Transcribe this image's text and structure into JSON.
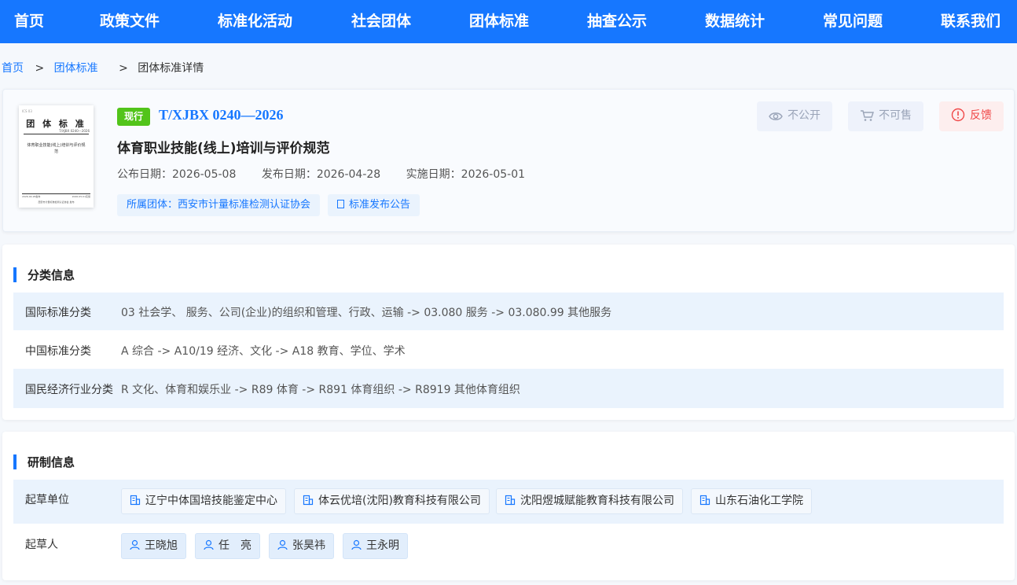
{
  "nav": {
    "items": [
      "首页",
      "政策文件",
      "标准化活动",
      "社会团体",
      "团体标准",
      "抽查公示",
      "数据统计",
      "常见问题",
      "联系我们"
    ]
  },
  "breadcrumb": {
    "home": "首页",
    "section": "团体标准",
    "current": "团体标准详情",
    "separator": ">"
  },
  "standard": {
    "status": "现行",
    "code": "T/XJBX 0240—2026",
    "title": "体育职业技能(线上)培训与评价规范",
    "dates": [
      {
        "label": "公布日期：",
        "value": "2026-05-08"
      },
      {
        "label": "发布日期：",
        "value": "2026-04-28"
      },
      {
        "label": "实施日期：",
        "value": "2026-05-01"
      }
    ],
    "org_tag": "所属团体：西安市计量标准检测认证协会",
    "announcement_tag": "标准发布公告"
  },
  "cover": {
    "ics": "ICS 03",
    "heading": "团 体 标 准",
    "code": "T/XJBX 0240—2026",
    "name": "体育职业技能(线上)培训与评价规范",
    "publish": "2026-04-28发布",
    "implement": "2026-05-01实施",
    "org": "西安市计量标准检测认证协会 发布"
  },
  "actions": {
    "private": "不公开",
    "not_for_sale": "不可售",
    "feedback": "反馈"
  },
  "classification": {
    "heading": "分类信息",
    "rows": [
      {
        "label": "国际标准分类",
        "value": "03 社会学、 服务、公司(企业)的组织和管理、行政、运输 -> 03.080 服务 -> 03.080.99 其他服务"
      },
      {
        "label": "中国标准分类",
        "value": "A 综合 -> A10/19 经济、文化 -> A18 教育、学位、学术"
      },
      {
        "label": "国民经济行业分类",
        "value": "R 文化、体育和娱乐业 -> R89 体育 -> R891 体育组织 -> R8919 其他体育组织"
      }
    ]
  },
  "drafting": {
    "heading": "研制信息",
    "units_label": "起草单位",
    "units": [
      "辽宁中体国培技能鉴定中心",
      "体云优培(沈阳)教育科技有限公司",
      "沈阳煜城赋能教育科技有限公司",
      "山东石油化工学院"
    ],
    "people_label": "起草人",
    "people": [
      "王晓旭",
      "任　亮",
      "张昊祎",
      "王永明"
    ]
  },
  "colors": {
    "primary": "#1677ff",
    "status_green": "#52c41a",
    "feedback_red": "#f04848",
    "row_stripe": "#eaf3fd"
  }
}
